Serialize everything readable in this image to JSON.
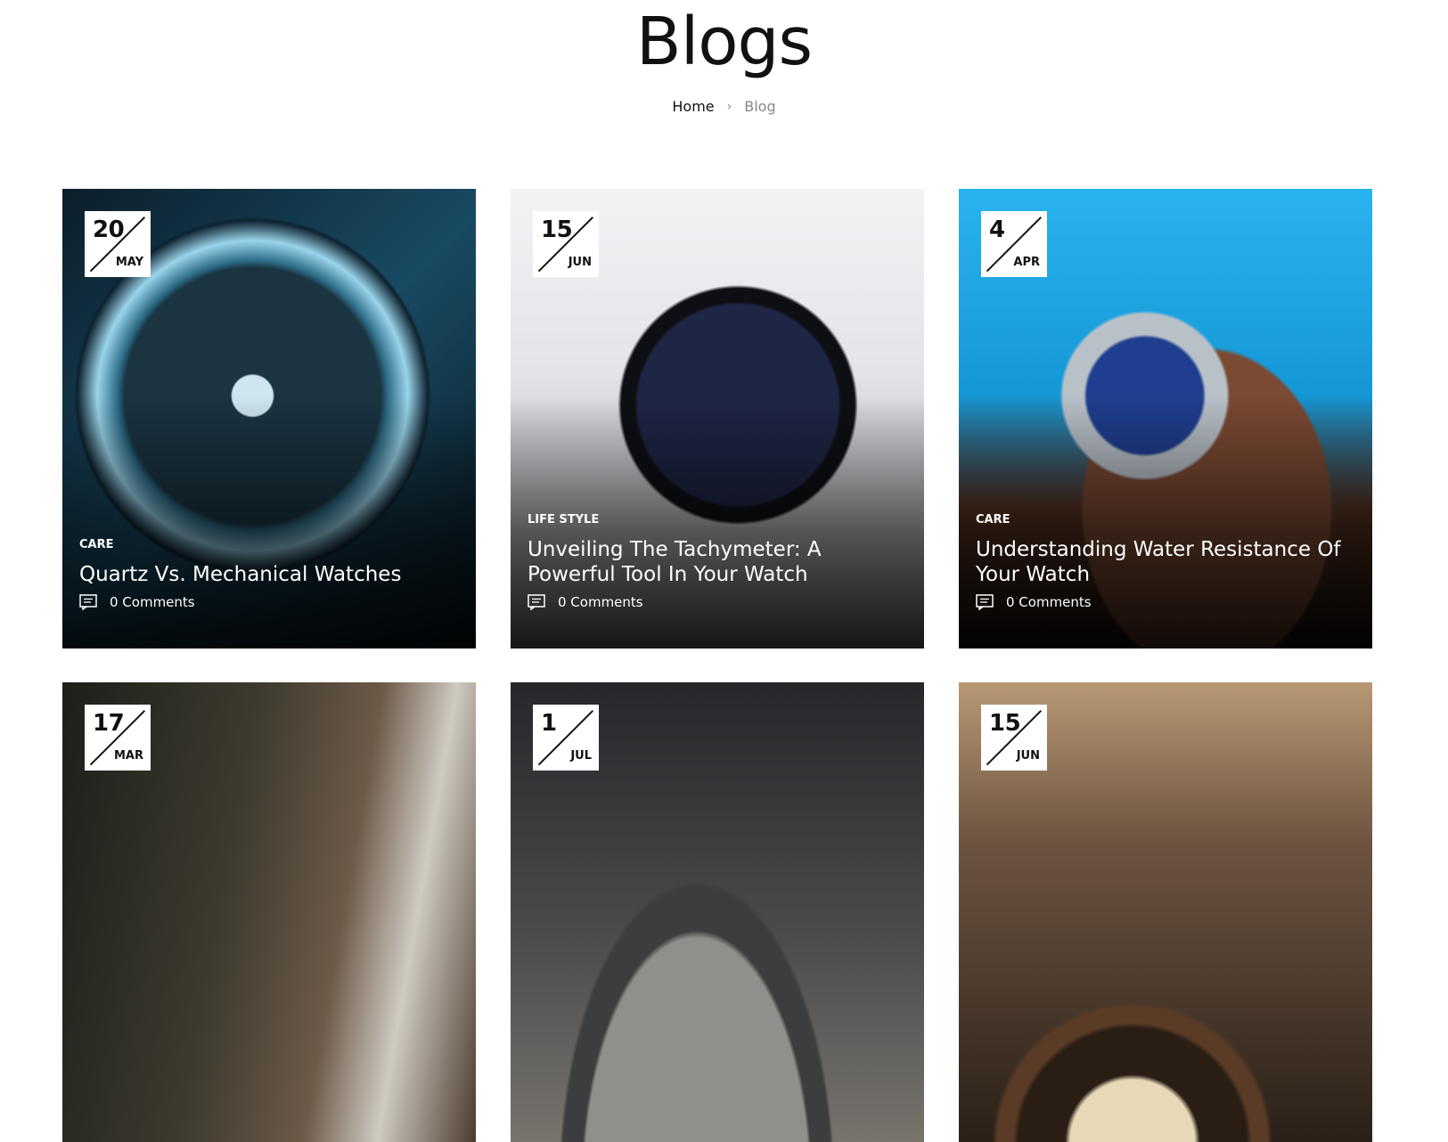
{
  "header": {
    "title": "Blogs",
    "breadcrumb": {
      "home": "Home",
      "separator": "›",
      "current": "Blog"
    }
  },
  "posts": [
    {
      "day": "20",
      "month": "MAY",
      "category": "CARE",
      "title": "Quartz Vs. Mechanical Watches",
      "comments": "0 Comments",
      "image_colors": [
        "#0f2c3d",
        "#1f6b8a",
        "#7fc6e3"
      ]
    },
    {
      "day": "15",
      "month": "JUN",
      "category": "LIFE STYLE",
      "title": "Unveiling The Tachymeter: A Powerful Tool In Your Watch",
      "comments": "0 Comments",
      "image_colors": [
        "#e9eaee",
        "#1b1f3a",
        "#3a3f5c"
      ]
    },
    {
      "day": "4",
      "month": "APR",
      "category": "CARE",
      "title": "Understanding Water Resistance Of Your Watch",
      "comments": "0 Comments",
      "image_colors": [
        "#1aa7e6",
        "#6b3d2a",
        "#9aa3ad"
      ]
    },
    {
      "day": "17",
      "month": "MAR",
      "image_colors": [
        "#2b2a24",
        "#5a4a3a",
        "#c8c3bb"
      ]
    },
    {
      "day": "1",
      "month": "JUL",
      "image_colors": [
        "#2e3033",
        "#6e6f70",
        "#a9a6a0"
      ]
    },
    {
      "day": "15",
      "month": "JUN",
      "image_colors": [
        "#3a2a1e",
        "#c49a6c",
        "#1b1b1b"
      ]
    }
  ]
}
